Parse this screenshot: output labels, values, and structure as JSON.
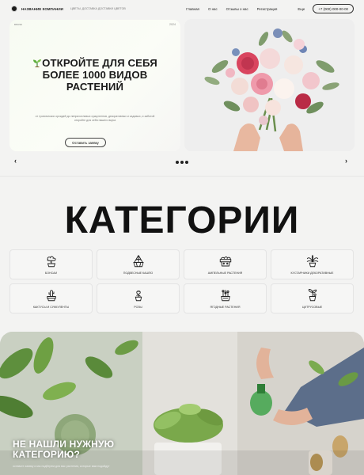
{
  "header": {
    "company_name": "НАЗВАНИЕ КОМПАНИИ",
    "tagline": "ЦВЕТЫ, ДОСТАВКА ДОСТАВКИ ЦВЕТОВ",
    "nav": [
      "Главная",
      "О нас",
      "Отзывы о нас",
      "Регистрация"
    ],
    "more": "Еще",
    "phone": "+7 (000) 000-00-00"
  },
  "hero": {
    "label_left": "весна",
    "label_right": "2024",
    "title_line1": "ОТКРОЙТЕ ДЛЯ СЕБЯ",
    "title_line2": "БОЛЕЕ 1000 ВИДОВ",
    "title_line3": "РАСТЕНИЙ",
    "subtitle_line1": "от тропических орхидей до неприхотливых суккулентов, декоративных и садовых, и заботой",
    "subtitle_line2": "откройте для себя нашего вкуса",
    "order_button": "Оставить заявку"
  },
  "slider": {
    "prev_arrow": "‹",
    "next_arrow": "›",
    "dot_count": 3
  },
  "categories": {
    "title": "КАТЕГОРИИ",
    "items": [
      {
        "label": "БОНСАИ",
        "icon": "bonsai-icon"
      },
      {
        "label": "ПОДВЕСНЫЕ КАШПО",
        "icon": "hanging-planter-icon"
      },
      {
        "label": "АМПЕЛЬНЫЕ РАСТЕНИЯ",
        "icon": "ampel-plant-icon"
      },
      {
        "label": "КУСТАРНИКИ ДЕКОРАТИВНЫЕ",
        "icon": "shrub-icon"
      },
      {
        "label": "КАКТУСЫ И СУККУЛЕНТЫ",
        "icon": "cactus-icon"
      },
      {
        "label": "РОЗЫ",
        "icon": "rose-icon"
      },
      {
        "label": "ЯГОДНЫЕ РАСТЕНИЯ",
        "icon": "berry-plant-icon"
      },
      {
        "label": "ЦИТРУСОВЫЕ",
        "icon": "citrus-icon"
      }
    ]
  },
  "banner": {
    "title_line1": "НЕ НАШЛИ НУЖНУЮ",
    "title_line2": "КАТЕГОРИЮ?",
    "subtitle": "оставьте заявку и мы подберем для вас растения, которые вам подойдут"
  }
}
